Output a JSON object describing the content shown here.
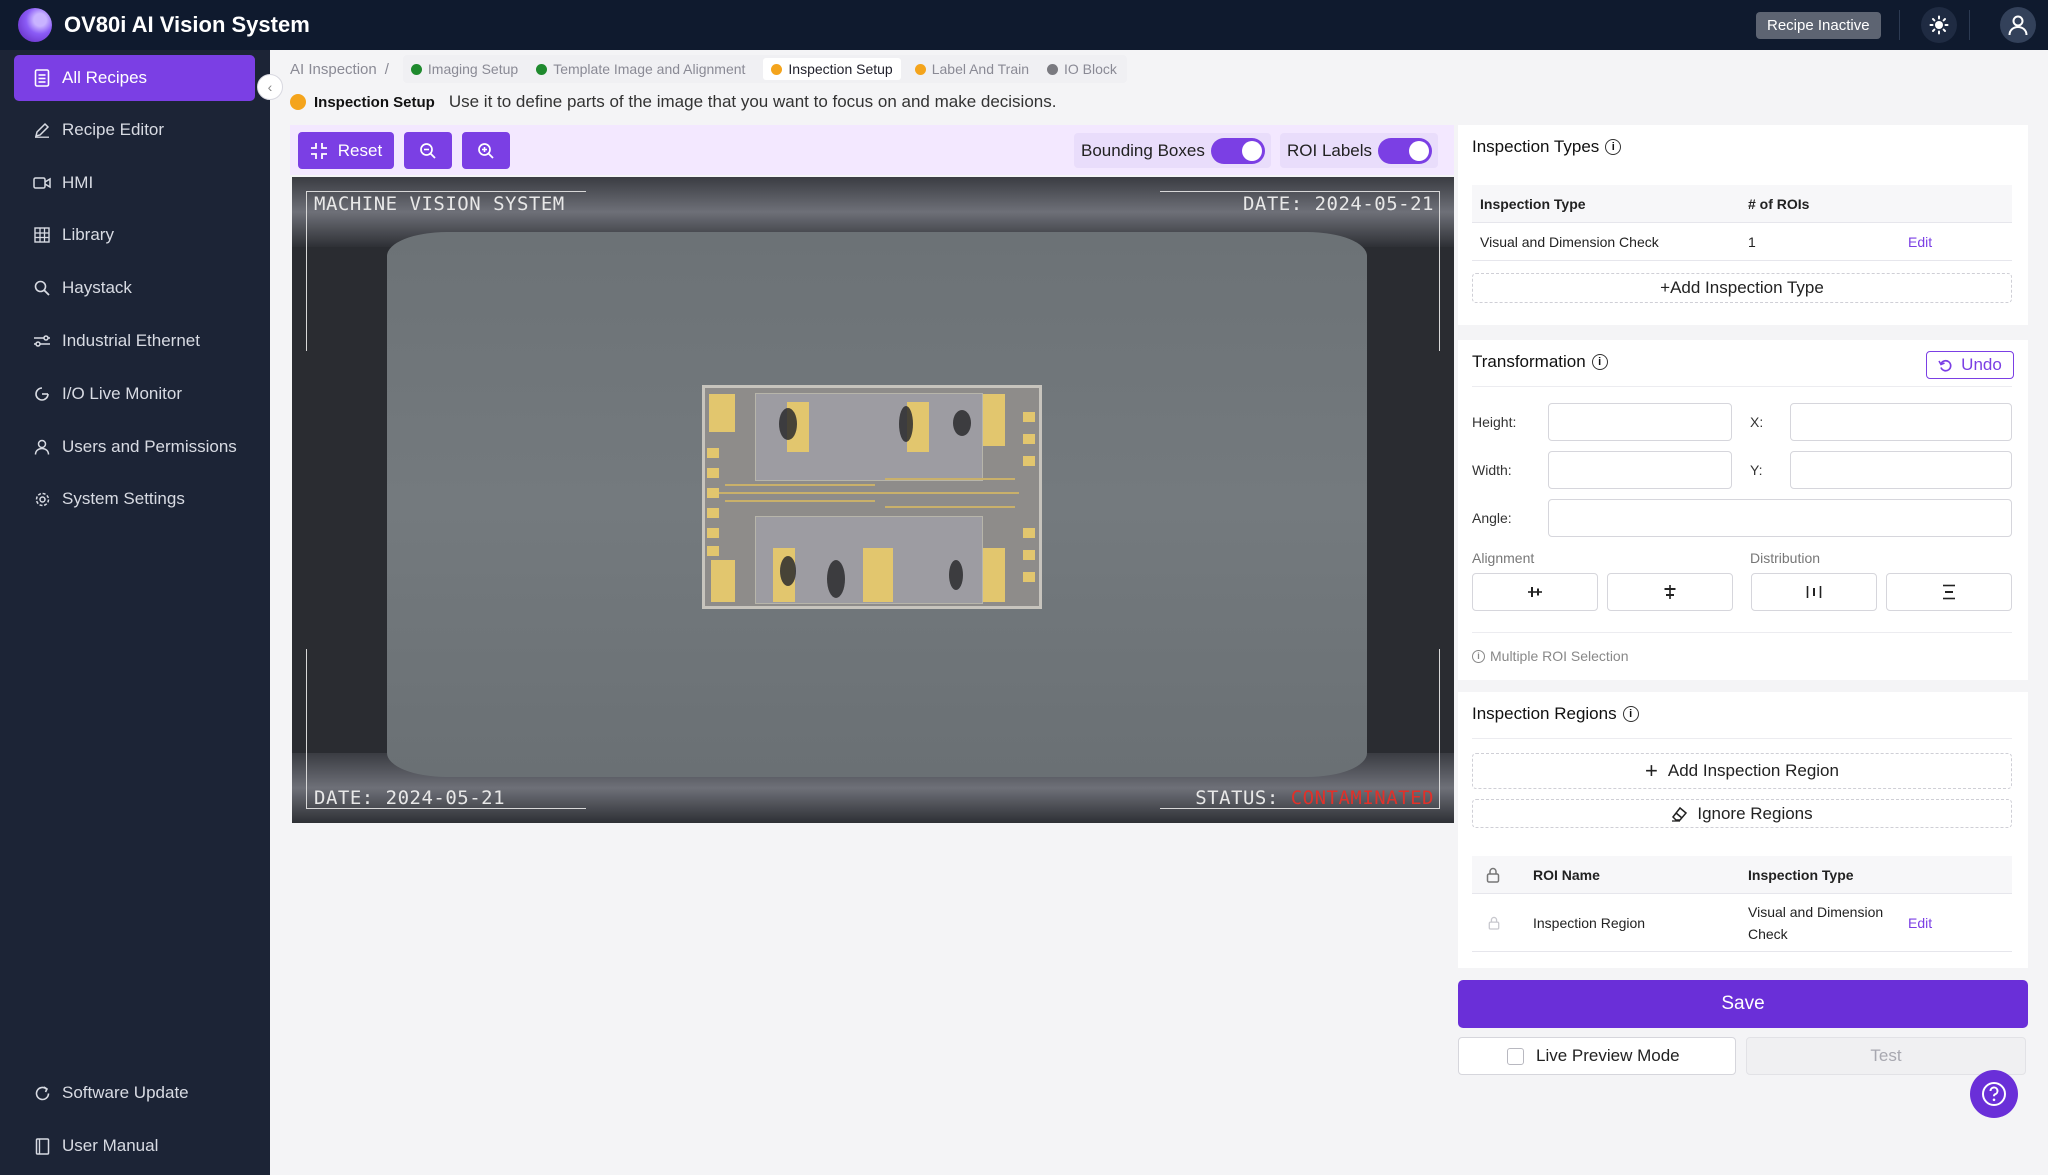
{
  "app": {
    "title": "OV80i AI Vision System",
    "recipe_status": "Recipe Inactive"
  },
  "icons": {
    "logo": "ov80i-logo-icon",
    "theme": "sun-icon",
    "user": "user-icon",
    "help": "question-icon"
  },
  "sidebar": {
    "items": [
      {
        "label": "All Recipes",
        "icon": "document-list-icon",
        "active": true
      },
      {
        "label": "Recipe Editor",
        "icon": "pencil-icon"
      },
      {
        "label": "HMI",
        "icon": "video-icon"
      },
      {
        "label": "Library",
        "icon": "grid-icon"
      },
      {
        "label": "Haystack",
        "icon": "search-icon"
      },
      {
        "label": "Industrial Ethernet",
        "icon": "network-icon"
      },
      {
        "label": "I/O Live Monitor",
        "icon": "monitor-icon"
      },
      {
        "label": "Users and Permissions",
        "icon": "user-icon"
      },
      {
        "label": "System Settings",
        "icon": "gear-icon"
      }
    ],
    "footer": [
      {
        "label": "Software Update",
        "icon": "refresh-icon"
      },
      {
        "label": "User Manual",
        "icon": "book-icon"
      }
    ]
  },
  "breadcrumb": {
    "root": "AI Inspection",
    "separator": "/",
    "steps": [
      {
        "label": "Imaging Setup",
        "status": "complete"
      },
      {
        "label": "Template Image and Alignment",
        "status": "complete"
      },
      {
        "label": "Inspection Setup",
        "status": "in-progress",
        "active": true
      },
      {
        "label": "Label And Train",
        "status": "in-progress"
      },
      {
        "label": "IO Block",
        "status": "inactive"
      }
    ]
  },
  "page": {
    "step_name": "Inspection Setup",
    "description": "Use it to define parts of the image that you want to focus on and make decisions."
  },
  "toolbar": {
    "reset_label": "Reset",
    "bounding_boxes_label": "Bounding Boxes",
    "bounding_boxes_on": true,
    "roi_labels_label": "ROI Labels",
    "roi_labels_on": true
  },
  "viewer": {
    "top_left": "MACHINE VISION SYSTEM",
    "top_right": "DATE: 2024-05-21",
    "bottom_left": "DATE: 2024-05-21",
    "status_label": "STATUS: ",
    "status_value": "CONTAMINATED"
  },
  "inspection_types": {
    "title": "Inspection Types",
    "columns": [
      "Inspection Type",
      "# of ROIs"
    ],
    "rows": [
      {
        "type": "Visual and Dimension Check",
        "rois": "1",
        "action": "Edit"
      }
    ],
    "add_label": "+Add Inspection Type"
  },
  "transformation": {
    "title": "Transformation",
    "undo_label": "Undo",
    "height_label": "Height:",
    "width_label": "Width:",
    "angle_label": "Angle:",
    "x_label": "X:",
    "y_label": "Y:",
    "alignment_label": "Alignment",
    "distribution_label": "Distribution",
    "multi_hint": "Multiple ROI Selection"
  },
  "inspection_regions": {
    "title": "Inspection Regions",
    "add_label": "Add Inspection Region",
    "ignore_label": "Ignore Regions",
    "columns": [
      "ROI Name",
      "Inspection Type"
    ],
    "rows": [
      {
        "name": "Inspection Region",
        "type": "Visual and Dimension Check",
        "action": "Edit"
      }
    ]
  },
  "actions": {
    "save_label": "Save",
    "live_preview_label": "Live Preview Mode",
    "test_label": "Test"
  },
  "colors": {
    "accent": "#7b3fe4",
    "topbar": "#0f1a2e",
    "sidebar": "#1c2436",
    "complete": "#1f8a2e",
    "in_progress": "#f4a41c",
    "alert": "#e0312a"
  }
}
